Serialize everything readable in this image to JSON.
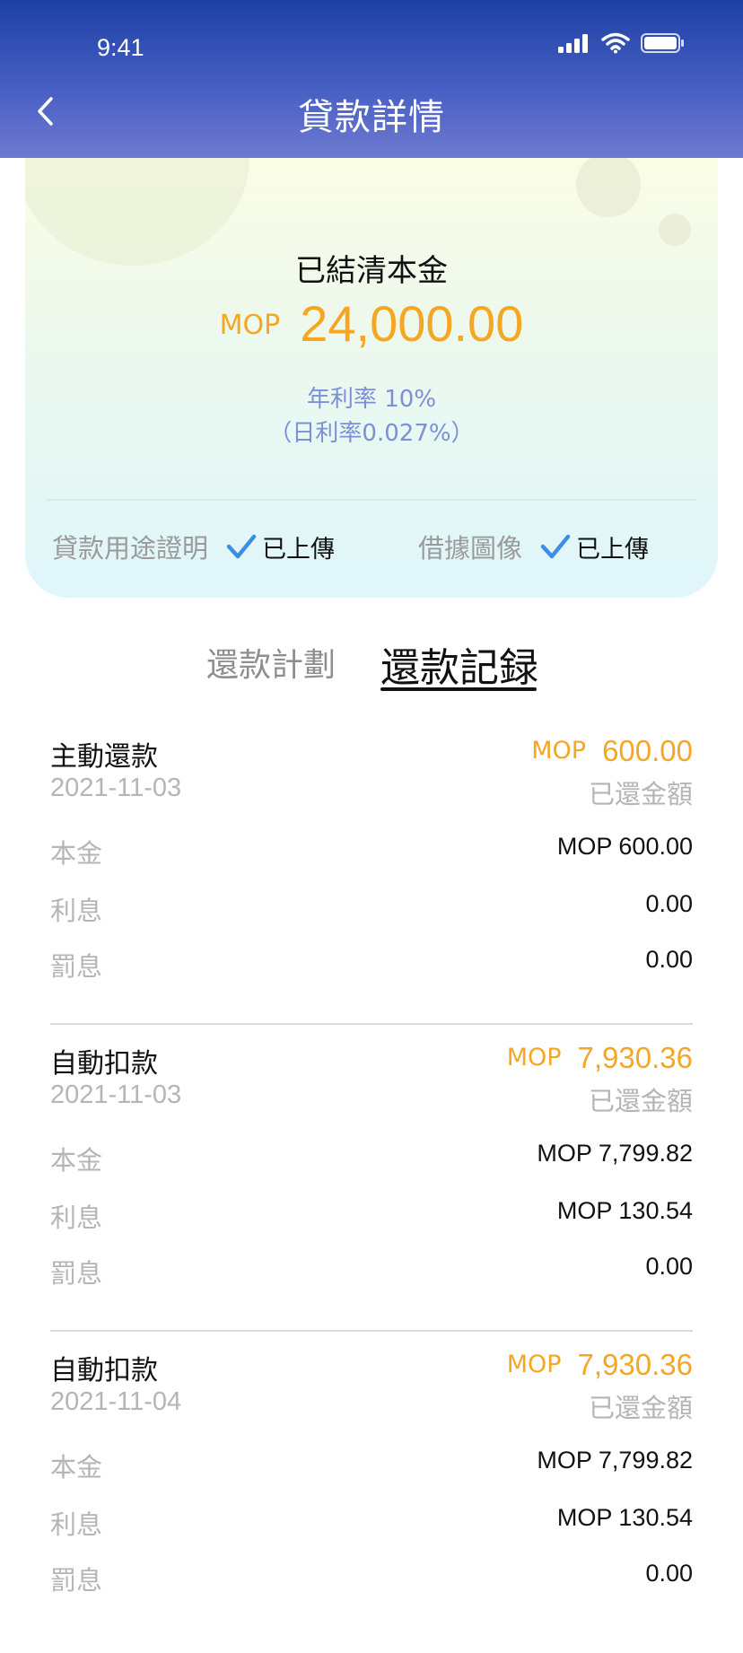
{
  "status_bar": {
    "time": "9:41"
  },
  "header": {
    "title": "貸款詳情"
  },
  "summary": {
    "label": "已結清本金",
    "currency": "MOP",
    "amount": "24,000.00",
    "annual_rate": "年利率 10%",
    "daily_rate": "（日利率0.027%）",
    "docs": [
      {
        "label": "貸款用途證明",
        "status": "已上傳"
      },
      {
        "label": "借據圖像",
        "status": "已上傳"
      }
    ]
  },
  "tabs": {
    "plan": "還款計劃",
    "record": "還款記録"
  },
  "records": [
    {
      "title": "主動還款",
      "date": "2021-11-03",
      "currency": "MOP",
      "amount": "600.00",
      "paid_label": "已還金額",
      "lines": [
        {
          "label": "本金",
          "value": "MOP 600.00"
        },
        {
          "label": "利息",
          "value": "0.00"
        },
        {
          "label": "罰息",
          "value": "0.00"
        }
      ]
    },
    {
      "title": "自動扣款",
      "date": "2021-11-03",
      "currency": "MOP",
      "amount": "7,930.36",
      "paid_label": "已還金額",
      "lines": [
        {
          "label": "本金",
          "value": "MOP 7,799.82"
        },
        {
          "label": "利息",
          "value": "MOP 130.54"
        },
        {
          "label": "罰息",
          "value": "0.00"
        }
      ]
    },
    {
      "title": "自動扣款",
      "date": "2021-11-04",
      "currency": "MOP",
      "amount": "7,930.36",
      "paid_label": "已還金額",
      "lines": [
        {
          "label": "本金",
          "value": "MOP 7,799.82"
        },
        {
          "label": "利息",
          "value": "MOP 130.54"
        },
        {
          "label": "罰息",
          "value": "0.00"
        }
      ]
    }
  ],
  "colors": {
    "accent": "#f5a623",
    "check": "#3a8ee6",
    "header": "#1e40a6"
  },
  "icons": [
    "back-icon",
    "signal-icon",
    "wifi-icon",
    "battery-icon",
    "check-icon"
  ]
}
